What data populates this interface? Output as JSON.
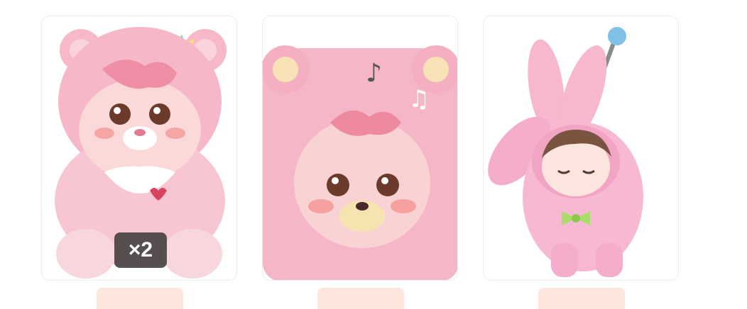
{
  "products": [
    {
      "name": "product-card-1",
      "quantity_badge": "×2",
      "tag": ""
    },
    {
      "name": "product-card-2",
      "quantity_badge": "",
      "tag": ""
    },
    {
      "name": "product-card-3",
      "quantity_badge": "",
      "tag": ""
    }
  ],
  "colors": {
    "pink": "#f6b7c8",
    "pink_dark": "#ef9fb4",
    "badge_bg": "#3a3a3a",
    "tag_bg": "#fde7dc"
  }
}
